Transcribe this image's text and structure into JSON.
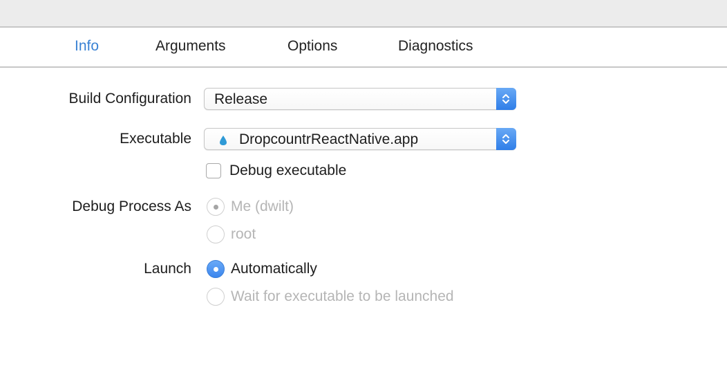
{
  "tabs": [
    {
      "label": "Info",
      "active": true
    },
    {
      "label": "Arguments",
      "active": false
    },
    {
      "label": "Options",
      "active": false
    },
    {
      "label": "Diagnostics",
      "active": false
    }
  ],
  "build_configuration": {
    "label": "Build Configuration",
    "value": "Release"
  },
  "executable": {
    "label": "Executable",
    "value": "DropcountrReactNative.app",
    "icon": "droplet-icon"
  },
  "debug_executable": {
    "label": "Debug executable",
    "checked": false
  },
  "debug_process_as": {
    "label": "Debug Process As",
    "options": [
      {
        "label": "Me (dwilt)",
        "selected": true,
        "enabled": false
      },
      {
        "label": "root",
        "selected": false,
        "enabled": false
      }
    ]
  },
  "launch": {
    "label": "Launch",
    "options": [
      {
        "label": "Automatically",
        "selected": true,
        "enabled": true
      },
      {
        "label": "Wait for executable to be launched",
        "selected": false,
        "enabled": false
      }
    ]
  },
  "colors": {
    "accent": "#3a82d4",
    "disabled_text": "#b5b5b5"
  }
}
